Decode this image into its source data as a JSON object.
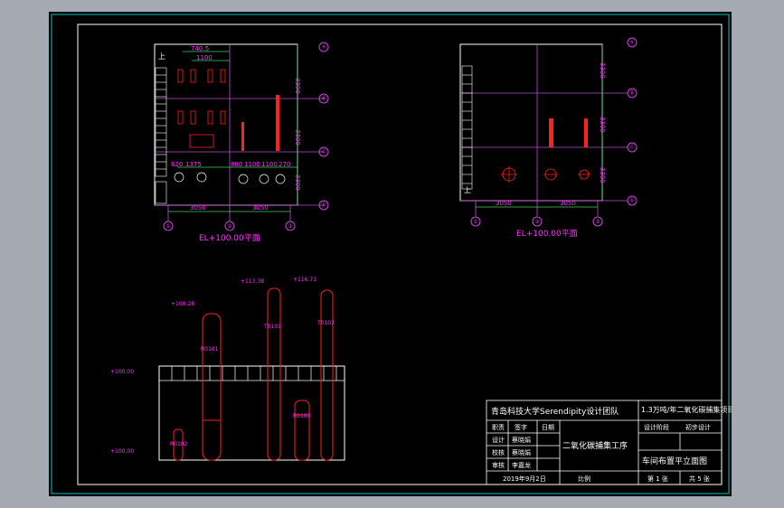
{
  "title_block": {
    "school": "青岛科技大学Serendipity设计团队",
    "project": "1.3万吨/年二氧化碳捕集项目",
    "work_section": "二氧化碳捕集工序",
    "drawing_name": "车间布置平立面图",
    "date": "2019年9月2日",
    "scale_label": "比例",
    "sheet_no": "第 1 张",
    "sheet_total": "共 5 张",
    "design_stage": "设计阶段",
    "design_stage_value": "初步设计",
    "header_role": "职责",
    "header_sign": "签字",
    "header_date": "日期",
    "roles": [
      "设计",
      "校核",
      "审核"
    ],
    "names": [
      "蔡晓娟",
      "蔡晓娟",
      "李嘉龙"
    ]
  },
  "plan_left": {
    "caption": "EL+100.00平面",
    "dims_bottom": [
      "3050",
      "3050"
    ],
    "dims_right": [
      "3300",
      "3300",
      "3300"
    ],
    "dims_top": [
      "740.5",
      "1100"
    ],
    "dims_inner_top": [
      "620",
      "1375"
    ],
    "dims_inner_right": [
      "880",
      "1100",
      "1100",
      "270"
    ],
    "axis_bottom": [
      "①",
      "②",
      "③"
    ],
    "axis_right": [
      "Ⓐ",
      "Ⓑ",
      "Ⓒ",
      "Ⓓ"
    ],
    "stair_label": "上"
  },
  "plan_right": {
    "caption": "EL+100.00平面",
    "dims_bottom": [
      "3050",
      "3050"
    ],
    "dims_right": [
      "3300",
      "3300",
      "3300"
    ],
    "axis_bottom": [
      "①",
      "②",
      "③"
    ],
    "axis_right": [
      "Ⓐ",
      "Ⓑ",
      "Ⓒ",
      "Ⓓ"
    ],
    "stair_label": "上"
  },
  "elevation": {
    "levels": [
      "+100.00",
      "+100.00",
      "+100.28",
      "+113.38",
      "+116.71"
    ],
    "equipment": [
      "R0101",
      "T0103",
      "T0102",
      "R0102",
      "R0103"
    ]
  },
  "colors": {
    "outline": "#ffffff",
    "grid": "#c24bd6",
    "dim": "#40d060",
    "equipment": "#ff2020",
    "text": "#ff33ff",
    "frame": "#00c8c8"
  }
}
